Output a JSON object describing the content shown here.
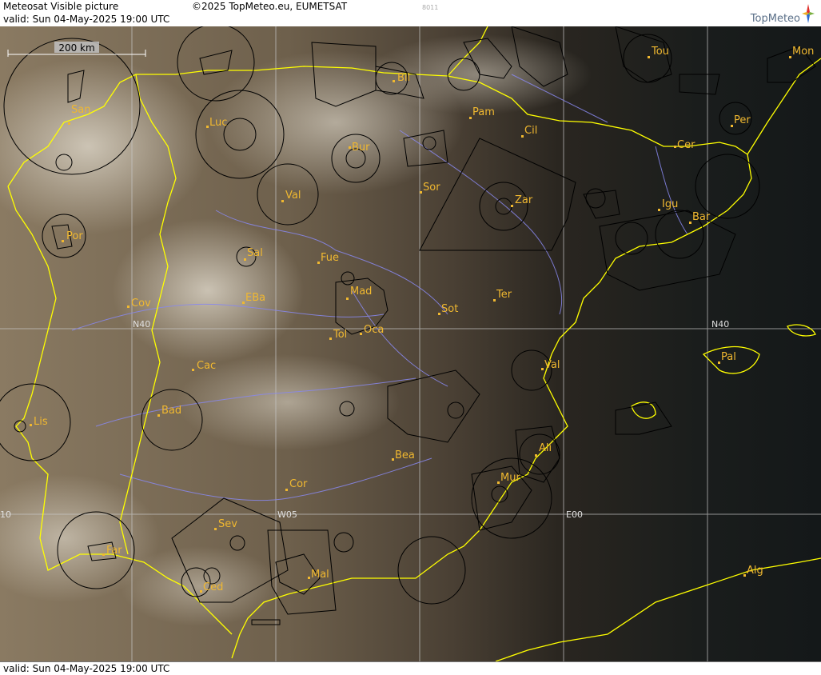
{
  "header": {
    "product": "Meteosat Visible picture",
    "copyright": "©2025 TopMeteo.eu, EUMETSAT",
    "frame_code": "8011",
    "valid": "valid:  Sun  04-May-2025  19:00 UTC",
    "logo_text": "TopMeteo"
  },
  "footer": {
    "valid": "valid:  Sun  04-May-2025  19:00 UTC"
  },
  "scale": {
    "label": "200 km"
  },
  "grid_labels": {
    "lat40_west": "N40",
    "lat40_east": "N40",
    "lon10": "10",
    "lonW05": "W05",
    "lonE00": "E00"
  },
  "cities": [
    "San",
    "Luc",
    "Bil",
    "Pam",
    "Cil",
    "Tou",
    "Mon",
    "Per",
    "Cer",
    "Bur",
    "Sor",
    "Zar",
    "Igu",
    "Bar",
    "Val",
    "Por",
    "Sal",
    "Fue",
    "Mad",
    "EBa",
    "Cov",
    "Sot",
    "Ter",
    "Tol",
    "Oca",
    "Cac",
    "Val",
    "Pal",
    "Bad",
    "Lis",
    "Bea",
    "Ali",
    "Mur",
    "Cor",
    "Sev",
    "Far",
    "Mal",
    "Ced",
    "Alg"
  ],
  "colors": {
    "city_label": "#f0b830",
    "coastline": "#ffff00",
    "rivers": "#8888ee",
    "airspace": "#000000",
    "grid": "#c8c8c8"
  }
}
